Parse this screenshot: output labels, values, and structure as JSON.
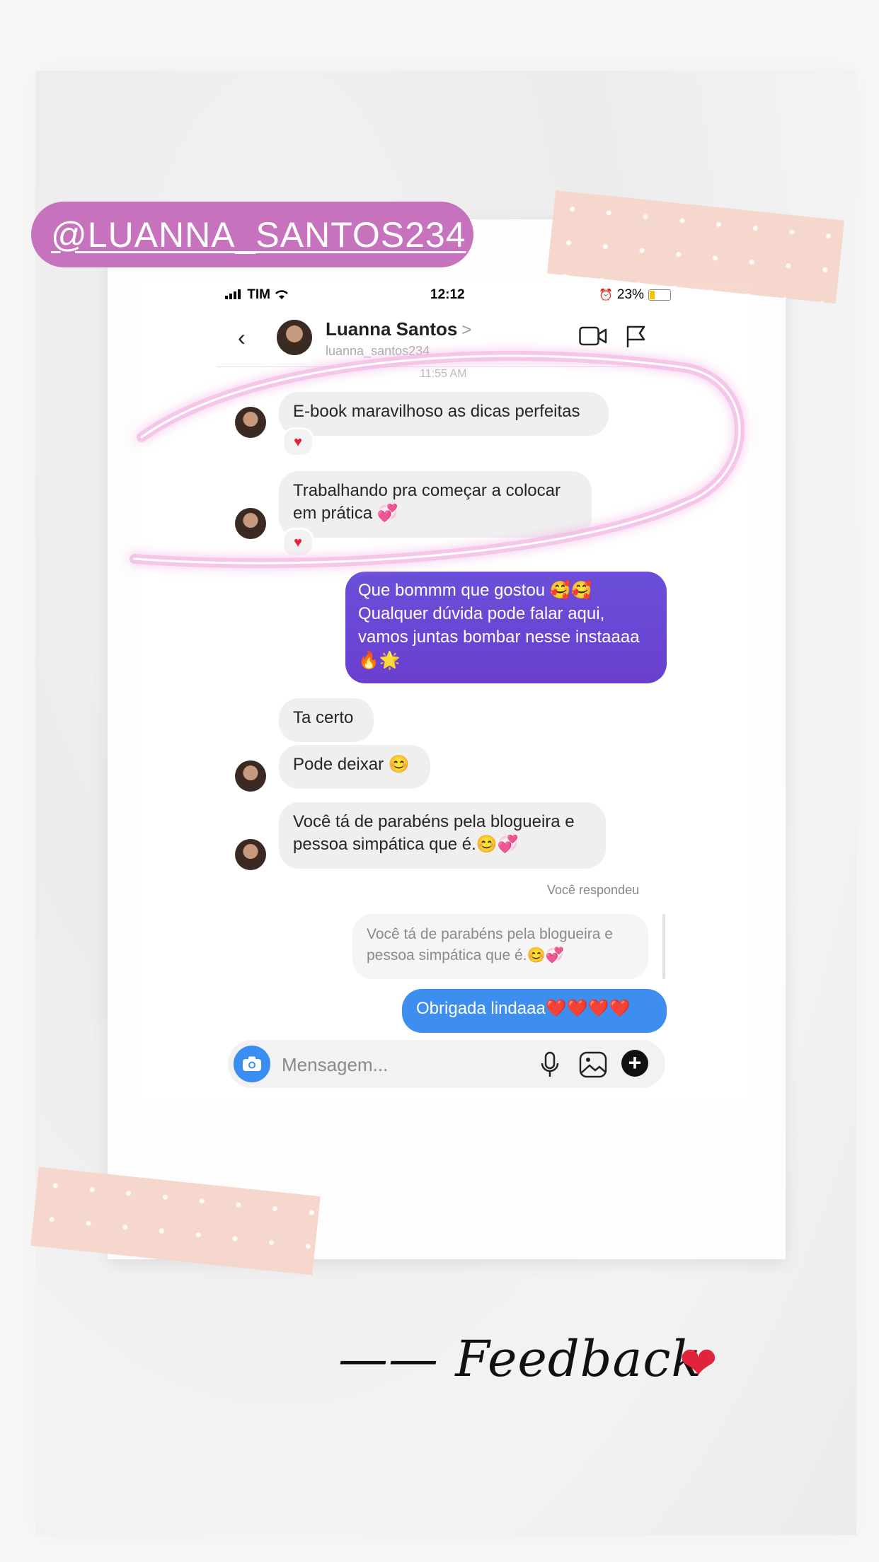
{
  "badge": {
    "username": "@LUANNA_SANTOS234"
  },
  "statusbar": {
    "carrier": "TIM",
    "time": "12:12",
    "battery": "23%"
  },
  "chat_header": {
    "name": "Luanna Santos",
    "chevron": ">",
    "username": "luanna_santos234",
    "timestamp": "11:55 AM"
  },
  "messages": [
    {
      "text": "E-book maravilhoso as dicas perfeitas",
      "reaction": "♥"
    },
    {
      "text": "Trabalhando pra começar a colocar\nem  prática 💞",
      "reaction": "♥"
    },
    {
      "text": "Que bommm que gostou 🥰🥰\nQualquer dúvida pode falar aqui,\nvamos juntas bombar nesse instaaaa\n🔥🌟"
    },
    {
      "text": "Ta certo"
    },
    {
      "text": "Pode deixar 😊"
    },
    {
      "text": "Você tá de parabéns pela blogueira e\npessoa simpática que é.😊💞"
    }
  ],
  "reply": {
    "label": "Você respondeu",
    "quoted": "Você tá de parabéns pela blogueira e\npessoa simpática que é.😊💞",
    "text": "Obrigada lindaaa❤️❤️❤️❤️"
  },
  "composer": {
    "placeholder": "Mensagem..."
  },
  "caption": {
    "text": "—— Feedback",
    "heart": "❤"
  },
  "colors": {
    "badge": "#c772bd",
    "sent_purple": "#6a3fd0",
    "sent_blue": "#3e8ef0",
    "tape": "#f6d6cc",
    "highlight": "#f3b8e6"
  },
  "icons": [
    "back-chevron",
    "video-call",
    "flag",
    "camera",
    "microphone",
    "gallery",
    "plus",
    "heart",
    "signal",
    "wifi",
    "alarm",
    "battery"
  ]
}
